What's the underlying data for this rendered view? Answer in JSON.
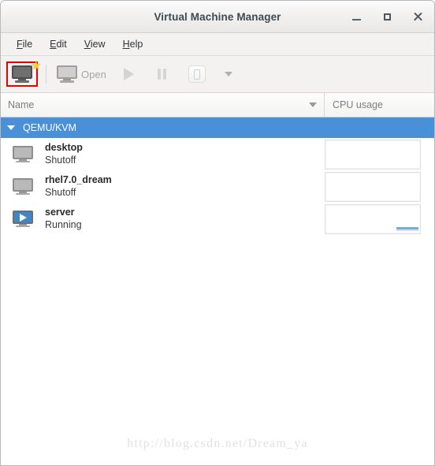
{
  "window": {
    "title": "Virtual Machine Manager",
    "controls": {
      "minimize_label": "Minimize",
      "maximize_label": "Maximize",
      "close_label": "Close"
    }
  },
  "menubar": {
    "items": [
      {
        "mnemonic": "F",
        "rest": "ile"
      },
      {
        "mnemonic": "E",
        "rest": "dit"
      },
      {
        "mnemonic": "V",
        "rest": "iew"
      },
      {
        "mnemonic": "H",
        "rest": "elp"
      }
    ]
  },
  "toolbar": {
    "new_vm_label": "",
    "open_label": "Open",
    "run_label": "",
    "pause_label": "",
    "shutdown_label": "",
    "dropdown_label": "",
    "highlight_color": "#e60000"
  },
  "columns": {
    "name": "Name",
    "cpu_usage": "CPU usage"
  },
  "connection": {
    "label": "QEMU/KVM",
    "expanded": true,
    "selected_color": "#4a90d9"
  },
  "vms": [
    {
      "name": "desktop",
      "state": "Shutoff",
      "running": false,
      "cpu_activity": false
    },
    {
      "name": "rhel7.0_dream",
      "state": "Shutoff",
      "running": false,
      "cpu_activity": false
    },
    {
      "name": "server",
      "state": "Running",
      "running": true,
      "cpu_activity": true
    }
  ],
  "watermark": {
    "text": "http://blog.csdn.net/Dream_ya"
  }
}
